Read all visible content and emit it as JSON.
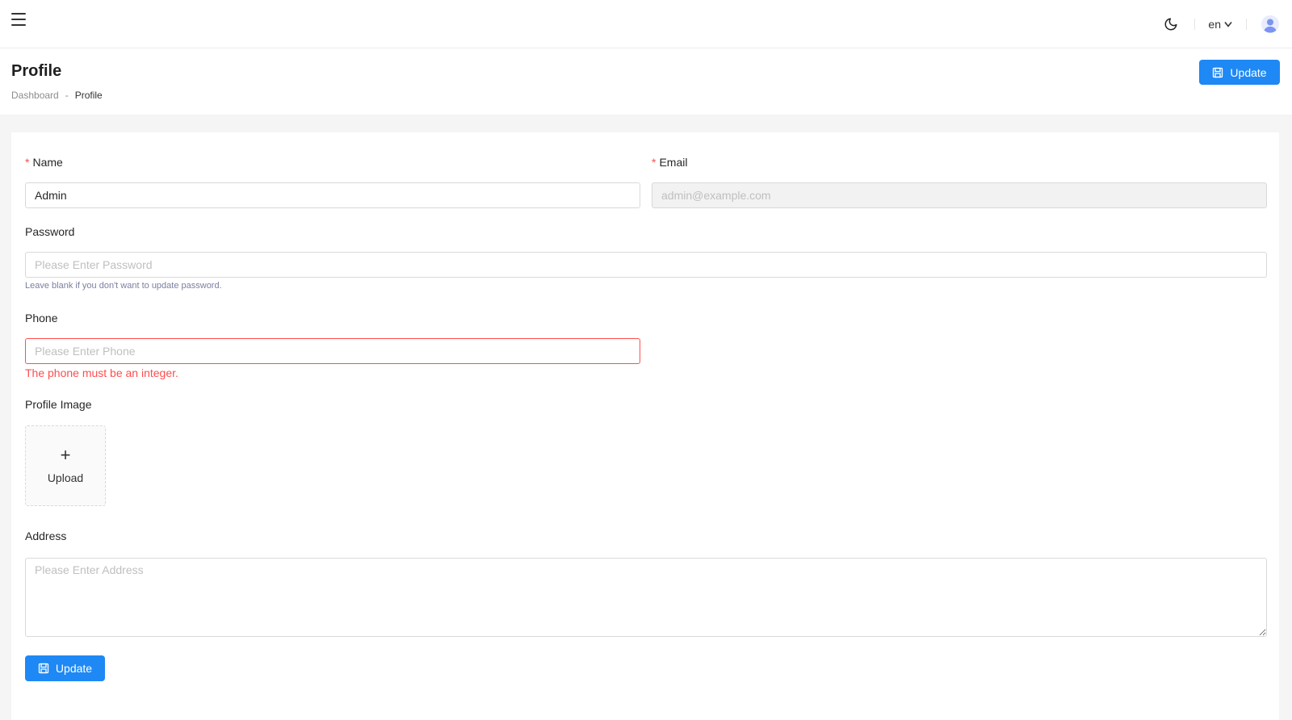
{
  "navbar": {
    "menu_icon": "hamburger-menu-icon",
    "theme_icon": "moon-icon",
    "language": "en",
    "language_icon": "chevron-down-icon",
    "avatar_icon": "user-avatar-icon"
  },
  "header": {
    "title": "Profile",
    "breadcrumb": {
      "home": "Dashboard",
      "separator": "-",
      "current": "Profile"
    },
    "update_label": "Update",
    "update_icon": "save-icon"
  },
  "form": {
    "name": {
      "label": "Name",
      "required_mark": "*",
      "value": "Admin"
    },
    "email": {
      "label": "Email",
      "required_mark": "*",
      "placeholder": "admin@example.com"
    },
    "password": {
      "label": "Password",
      "placeholder": "Please Enter Password",
      "help": "Leave blank if you don't want to update password."
    },
    "phone": {
      "label": "Phone",
      "placeholder": "Please Enter Phone",
      "error": "The phone must be an integer."
    },
    "profile_image": {
      "label": "Profile Image",
      "plus": "+",
      "upload_label": "Upload"
    },
    "address": {
      "label": "Address",
      "placeholder": "Please Enter Address"
    },
    "submit_label": "Update"
  },
  "colors": {
    "primary": "#1e88f5",
    "error": "#ff4d4f"
  }
}
